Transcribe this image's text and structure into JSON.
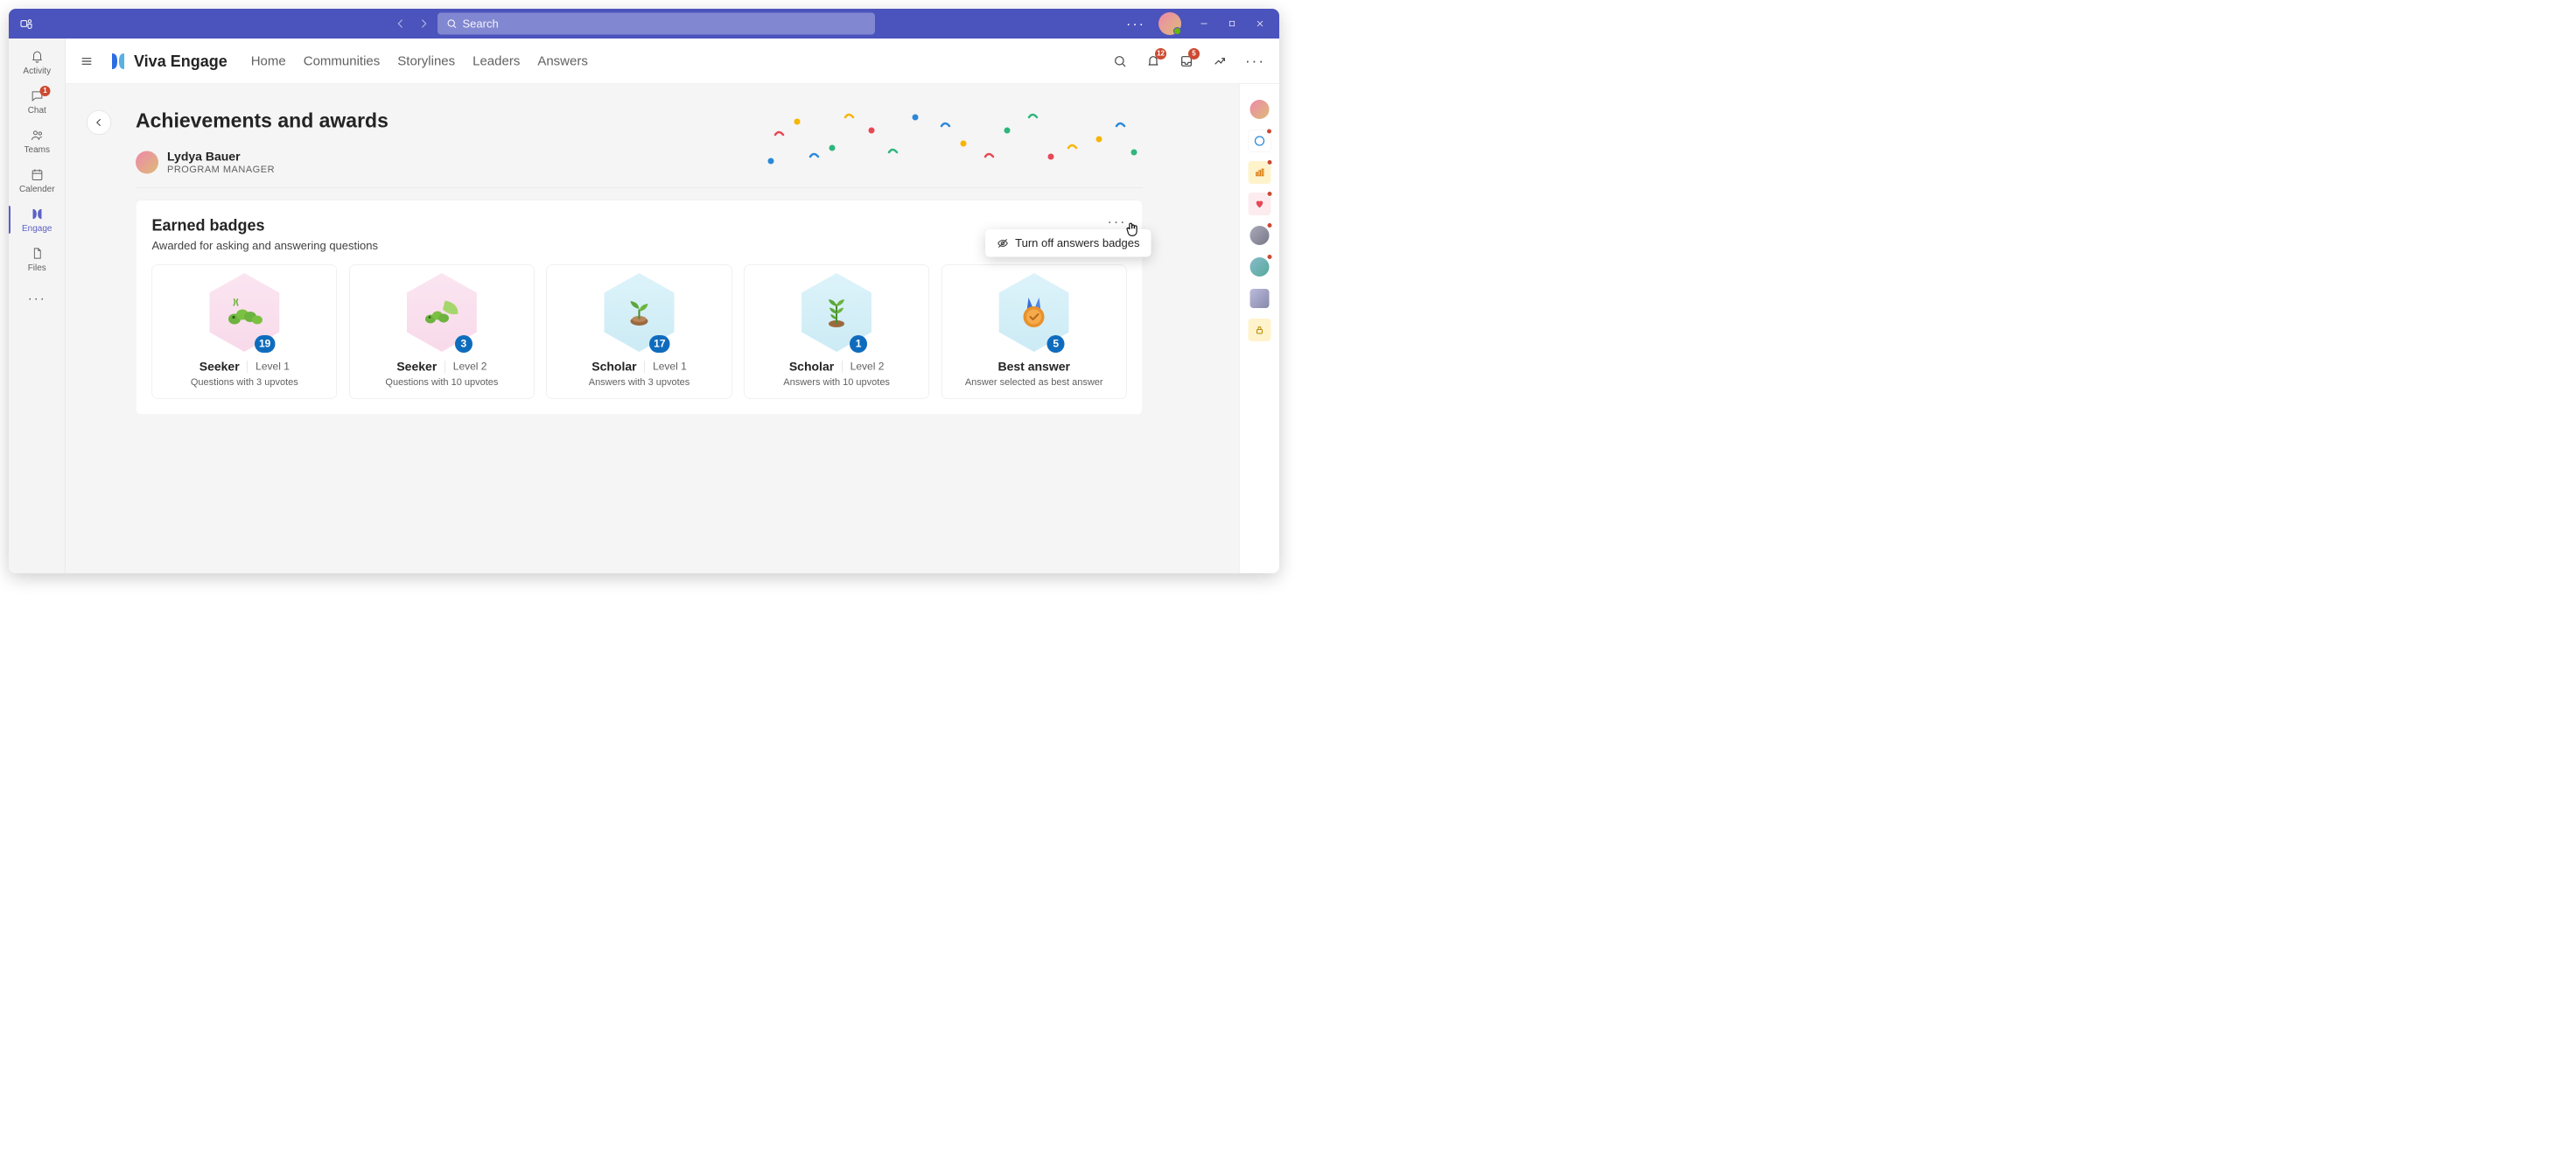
{
  "titlebar": {
    "search_placeholder": "Search"
  },
  "rail": {
    "items": [
      {
        "label": "Activity",
        "badge": null
      },
      {
        "label": "Chat",
        "badge": "1"
      },
      {
        "label": "Teams",
        "badge": null
      },
      {
        "label": "Calender",
        "badge": null
      },
      {
        "label": "Engage",
        "badge": null
      },
      {
        "label": "Files",
        "badge": null
      }
    ]
  },
  "topbar": {
    "brand": "Viva Engage",
    "nav": [
      "Home",
      "Communities",
      "Storylines",
      "Leaders",
      "Answers"
    ],
    "bell_badge": "12",
    "inbox_badge": "5"
  },
  "page": {
    "title": "Achievements and awards",
    "user": {
      "name": "Lydya Bauer",
      "title": "PROGRAM MANAGER"
    }
  },
  "panel": {
    "title": "Earned badges",
    "subtitle": "Awarded for asking and answering questions",
    "popover_label": "Turn off answers badges"
  },
  "badges": [
    {
      "name": "Seeker",
      "level": "Level 1",
      "desc": "Questions with 3 upvotes",
      "count": "19"
    },
    {
      "name": "Seeker",
      "level": "Level 2",
      "desc": "Questions with 10 upvotes",
      "count": "3"
    },
    {
      "name": "Scholar",
      "level": "Level 1",
      "desc": "Answers with 3 upvotes",
      "count": "17"
    },
    {
      "name": "Scholar",
      "level": "Level 2",
      "desc": "Answers with 10 upvotes",
      "count": "1"
    },
    {
      "name": "Best answer",
      "level": "",
      "desc": "Answer selected as best answer",
      "count": "5"
    }
  ]
}
